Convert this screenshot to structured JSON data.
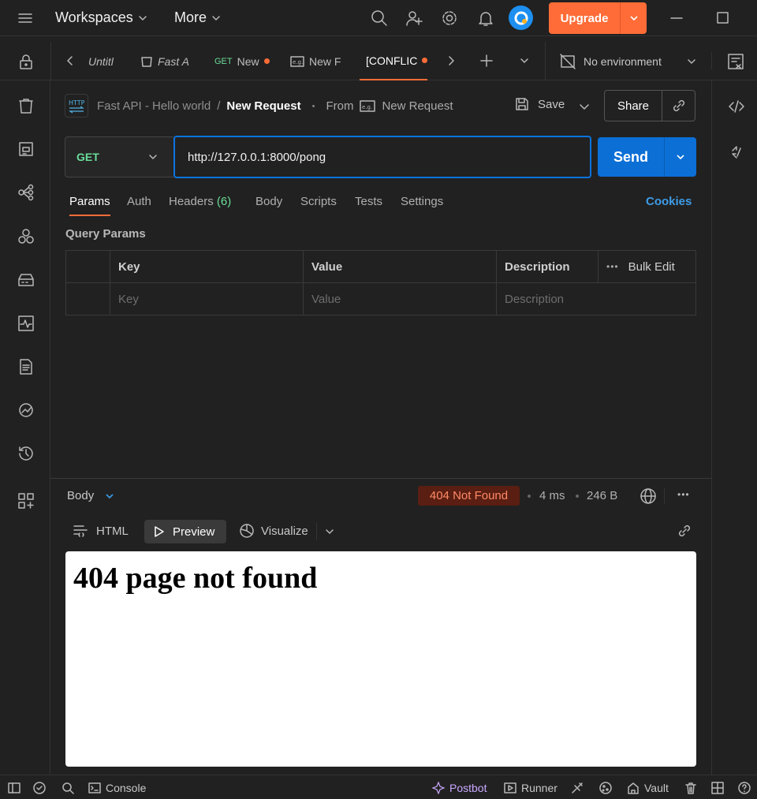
{
  "topbar": {
    "workspaces": "Workspaces",
    "more": "More",
    "upgrade": "Upgrade"
  },
  "tabs": [
    {
      "label": "Untitl"
    },
    {
      "label": "Fast A"
    },
    {
      "method": "GET",
      "label": "New"
    },
    {
      "label": "New F"
    },
    {
      "label": "[CONFLIC"
    }
  ],
  "environment": "No environment",
  "breadcrumb": {
    "collection": "Fast API - Hello world",
    "separator": "/",
    "request": "New Request",
    "from_label": "From",
    "from_request": "New Request"
  },
  "actions": {
    "save": "Save",
    "share": "Share"
  },
  "request": {
    "method": "GET",
    "url": "http://127.0.0.1:8000/pong",
    "send": "Send"
  },
  "request_tabs": {
    "params": "Params",
    "auth": "Auth",
    "headers": "Headers",
    "headers_count": "(6)",
    "body": "Body",
    "scripts": "Scripts",
    "tests": "Tests",
    "settings": "Settings",
    "cookies": "Cookies"
  },
  "query_params": {
    "title": "Query Params",
    "columns": {
      "key": "Key",
      "value": "Value",
      "description": "Description",
      "bulk_edit": "Bulk Edit"
    },
    "placeholder": {
      "key": "Key",
      "value": "Value",
      "description": "Description"
    }
  },
  "response": {
    "body_label": "Body",
    "status": "404 Not Found",
    "time": "4 ms",
    "size": "246 B",
    "views": {
      "html": "HTML",
      "preview": "Preview",
      "visualize": "Visualize"
    },
    "preview_heading": "404 page not found"
  },
  "statusbar": {
    "console": "Console",
    "postbot": "Postbot",
    "runner": "Runner",
    "vault": "Vault"
  },
  "colors": {
    "accent": "#ff6c37",
    "send": "#0b6fd6",
    "get": "#6bdd9a",
    "error_bg": "#5a1e12",
    "error_text": "#ff8a66",
    "link": "#3d9ce8"
  }
}
